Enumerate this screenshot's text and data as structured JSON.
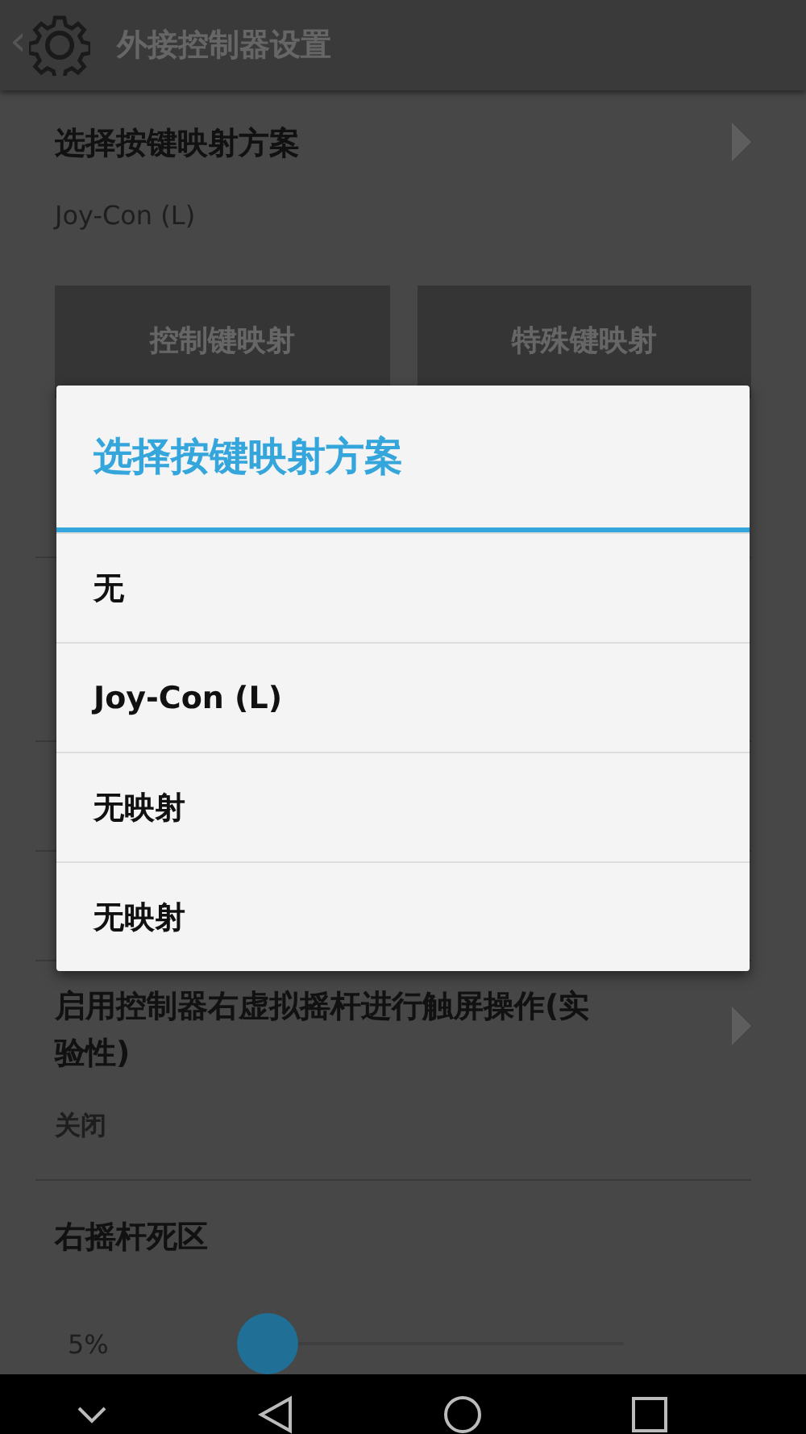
{
  "header": {
    "back": "‹",
    "title": "外接控制器设置"
  },
  "mapping_setting": {
    "title": "选择按键映射方案",
    "value": "Joy-Con (L)"
  },
  "buttons": [
    "控制键映射",
    "特殊键映射"
  ],
  "joystick_setting": {
    "title": "启用控制器右虚拟摇杆进行触屏操作(实验性)",
    "value": "关闭"
  },
  "deadzone_setting": {
    "title": "右摇杆死区",
    "reading": "5%",
    "level": 0.05
  },
  "dialog": {
    "title": "选择按键映射方案",
    "options": [
      "无",
      "Joy-Con (L)",
      "无映射",
      "无映射"
    ]
  }
}
